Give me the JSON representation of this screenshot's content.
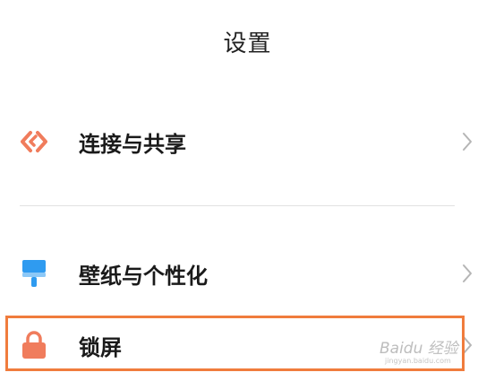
{
  "header": {
    "title": "设置"
  },
  "items": [
    {
      "label": "连接与共享",
      "icon": "connection-share-icon",
      "icon_color": "#f07c5c"
    },
    {
      "label": "壁纸与个性化",
      "icon": "wallpaper-brush-icon",
      "icon_color": "#2f9bf0"
    },
    {
      "label": "锁屏",
      "icon": "lock-icon",
      "icon_color": "#f07c5c"
    }
  ],
  "highlight_color": "#f07c3d",
  "watermark": {
    "text": "Baidu 经验",
    "sub": "jingyan.baidu.com"
  }
}
